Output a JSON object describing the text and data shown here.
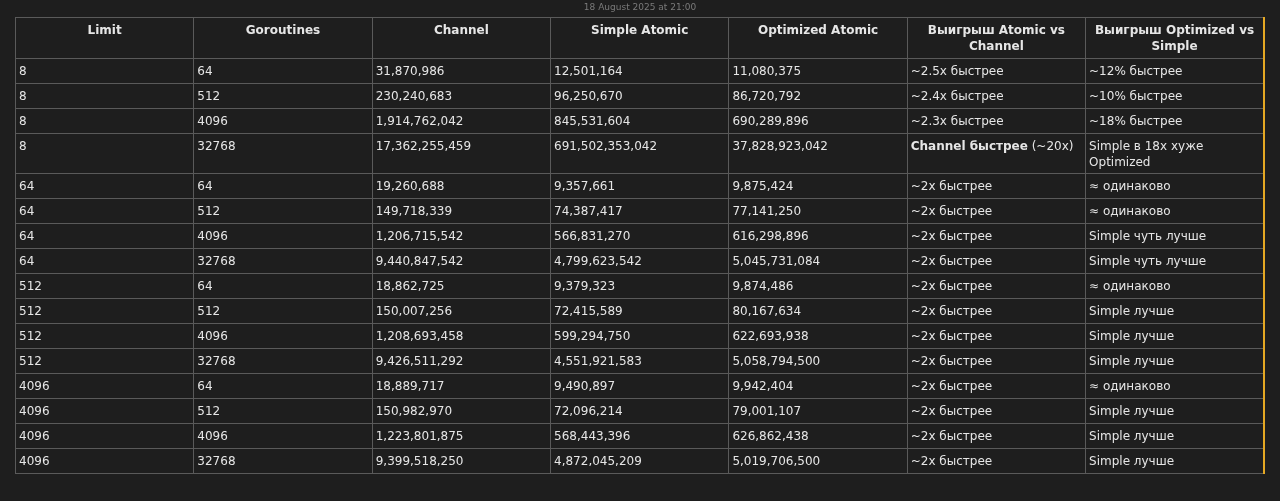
{
  "timestamp": "18 August 2025 at 21:00",
  "table": {
    "columns": [
      "Limit",
      "Goroutines",
      "Channel",
      "Simple Atomic",
      "Optimized Atomic",
      "Выигрыш Atomic vs Channel",
      "Выигрыш Optimized vs Simple"
    ],
    "rows": [
      [
        "8",
        "64",
        "31,870,986",
        "12,501,164",
        "11,080,375",
        "~2.5x быстрее",
        "~12% быстрее"
      ],
      [
        "8",
        "512",
        "230,240,683",
        "96,250,670",
        "86,720,792",
        "~2.4x быстрее",
        "~10% быстрее"
      ],
      [
        "8",
        "4096",
        "1,914,762,042",
        "845,531,604",
        "690,289,896",
        "~2.3x быстрее",
        "~18% быстрее"
      ],
      [
        "8",
        "32768",
        "17,362,255,459",
        "691,502,353,042",
        "37,828,923,042",
        "**Channel быстрее** (~20x)",
        "Simple в 18x хуже Optimized"
      ],
      [
        "64",
        "64",
        "19,260,688",
        "9,357,661",
        "9,875,424",
        "~2x быстрее",
        "≈ одинаково"
      ],
      [
        "64",
        "512",
        "149,718,339",
        "74,387,417",
        "77,141,250",
        "~2x быстрее",
        "≈ одинаково"
      ],
      [
        "64",
        "4096",
        "1,206,715,542",
        "566,831,270",
        "616,298,896",
        "~2x быстрее",
        "Simple чуть лучше"
      ],
      [
        "64",
        "32768",
        "9,440,847,542",
        "4,799,623,542",
        "5,045,731,084",
        "~2x быстрее",
        "Simple чуть лучше"
      ],
      [
        "512",
        "64",
        "18,862,725",
        "9,379,323",
        "9,874,486",
        "~2x быстрее",
        "≈ одинаково"
      ],
      [
        "512",
        "512",
        "150,007,256",
        "72,415,589",
        "80,167,634",
        "~2x быстрее",
        "Simple лучше"
      ],
      [
        "512",
        "4096",
        "1,208,693,458",
        "599,294,750",
        "622,693,938",
        "~2x быстрее",
        "Simple лучше"
      ],
      [
        "512",
        "32768",
        "9,426,511,292",
        "4,551,921,583",
        "5,058,794,500",
        "~2x быстрее",
        "Simple лучше"
      ],
      [
        "4096",
        "64",
        "18,889,717",
        "9,490,897",
        "9,942,404",
        "~2x быстрее",
        "≈ одинаково"
      ],
      [
        "4096",
        "512",
        "150,982,970",
        "72,096,214",
        "79,001,107",
        "~2x быстрее",
        "Simple лучше"
      ],
      [
        "4096",
        "4096",
        "1,223,801,875",
        "568,443,396",
        "626,862,438",
        "~2x быстрее",
        "Simple лучше"
      ],
      [
        "4096",
        "32768",
        "9,399,518,250",
        "4,872,045,209",
        "5,019,706,500",
        "~2x быстрее",
        "Simple лучше"
      ]
    ]
  }
}
